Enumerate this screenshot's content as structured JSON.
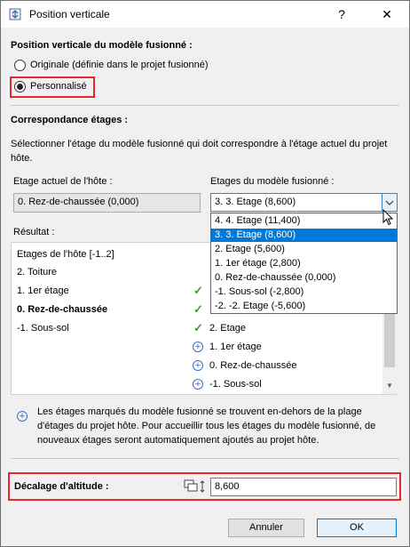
{
  "window": {
    "title": "Position verticale",
    "help_label": "?",
    "close_label": "✕"
  },
  "vertical_position": {
    "heading": "Position verticale du modèle fusionné :",
    "option_original": "Originale (définie dans le projet fusionné)",
    "option_custom": "Personnalisé",
    "selected": "Personnalisé"
  },
  "floor_mapping": {
    "heading": "Correspondance étages :",
    "description": "Sélectionner l'étage du modèle fusionné qui doit correspondre à l'étage actuel du projet hôte.",
    "host_label": "Etage actuel de l'hôte :",
    "host_value": "0. Rez-de-chaussée (0,000)",
    "merged_label": "Etages du modèle fusionné :",
    "merged_value": "3. 3. Etage (8,600)",
    "options": [
      "4. 4. Etage (11,400)",
      "3. 3. Etage (8,600)",
      "2. Etage (5,600)",
      "1. 1er étage (2,800)",
      "0. Rez-de-chaussée (0,000)",
      "-1. Sous-sol (-2,800)",
      "-2. -2. Etage (-5,600)"
    ]
  },
  "result": {
    "label": "Résultat :",
    "host_header": "Etages de l'hôte [-1..2]",
    "host_rows": [
      "2. Toiture",
      "1. 1er étage",
      "0. Rez-de-chaussée",
      "-1. Sous-sol"
    ],
    "merged_rows": [
      "2. Etage",
      "1. 1er étage",
      "0. Rez-de-chaussée",
      "-1. Sous-sol"
    ]
  },
  "info_text": "Les étages marqués du modèle fusionné se trouvent en-dehors de la plage d'étages du projet hôte. Pour accueillir tous les étages du modèle fusionné, de nouveaux étages seront automatiquement ajoutés au projet hôte.",
  "altitude": {
    "label": "Décalage d'altitude :",
    "value": "8,600"
  },
  "buttons": {
    "cancel": "Annuler",
    "ok": "OK"
  },
  "colors": {
    "highlight": "#e8262b",
    "selection": "#0078d7",
    "check": "#3f9b2c",
    "plus": "#3b6fc7"
  }
}
